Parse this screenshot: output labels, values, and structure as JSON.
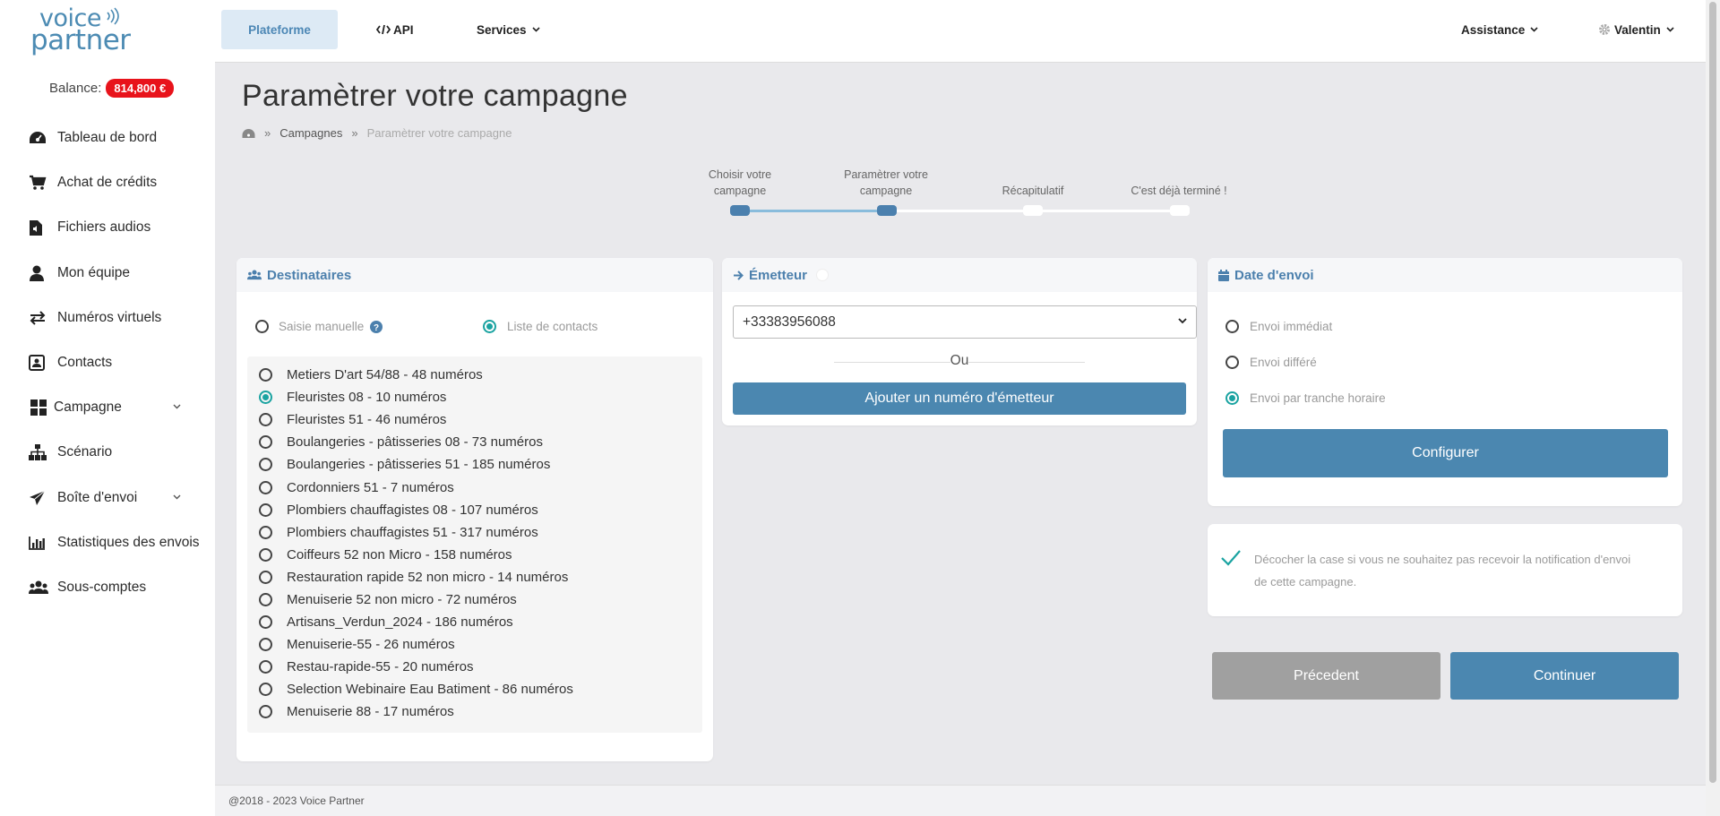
{
  "logo": {
    "line1": "voice",
    "line2": "partner"
  },
  "balance": {
    "label": "Balance:",
    "amount": "814,800 €"
  },
  "sidebar": {
    "items": [
      {
        "label": "Tableau de bord",
        "icon": "dashboard-icon"
      },
      {
        "label": "Achat de crédits",
        "icon": "cart-icon"
      },
      {
        "label": "Fichiers audios",
        "icon": "audio-file-icon"
      },
      {
        "label": "Mon équipe",
        "icon": "user-icon"
      },
      {
        "label": "Numéros virtuels",
        "icon": "exchange-icon"
      },
      {
        "label": "Contacts",
        "icon": "contact-card-icon"
      },
      {
        "label": "Campagne",
        "icon": "grid-icon"
      },
      {
        "label": "Scénario",
        "icon": "sitemap-icon"
      },
      {
        "label": "Boîte d'envoi",
        "icon": "paper-plane-icon"
      },
      {
        "label": "Statistiques des envois",
        "icon": "bar-chart-icon"
      },
      {
        "label": "Sous-comptes",
        "icon": "users-icon"
      }
    ]
  },
  "topbar": {
    "plateforme": "Plateforme",
    "api": "API",
    "services": "Services",
    "assistance": "Assistance",
    "user": "Valentin"
  },
  "page": {
    "title": "Paramètrer votre campagne",
    "breadcrumb": {
      "sep": "»",
      "campagnes": "Campagnes",
      "current": "Paramètrer votre campagne"
    }
  },
  "stepper": {
    "steps": [
      {
        "line1": "Choisir votre",
        "line2": "campagne"
      },
      {
        "line1": "Paramètrer votre",
        "line2": "campagne"
      },
      {
        "line1": "Récapitulatif",
        "line2": ""
      },
      {
        "line1": "C'est déjà terminé !",
        "line2": ""
      }
    ],
    "current_step": 2
  },
  "destinataires": {
    "title": "Destinataires",
    "mode_manual": "Saisie manuelle",
    "mode_list": "Liste de contacts",
    "selected_mode": "Liste de contacts",
    "lists": [
      "Metiers D'art 54/88 - 48 numéros",
      "Fleuristes 08 - 10 numéros",
      "Fleuristes 51 - 46 numéros",
      "Boulangeries - pâtisseries 08 - 73 numéros",
      "Boulangeries - pâtisseries 51 - 185 numéros",
      "Cordonniers 51 - 7 numéros",
      "Plombiers chauffagistes 08 - 107 numéros",
      "Plombiers chauffagistes 51 - 317 numéros",
      "Coiffeurs 52 non Micro - 158 numéros",
      "Restauration rapide 52 non micro - 14 numéros",
      "Menuiserie 52 non micro - 72 numéros",
      "Artisans_Verdun_2024 - 186 numéros",
      "Menuiserie-55 - 26 numéros",
      "Restau-rapide-55 - 20 numéros",
      "Selection Webinaire Eau Batiment - 86 numéros",
      "Menuiserie 88 - 17 numéros"
    ],
    "selected_list": "Fleuristes 08 - 10 numéros"
  },
  "emetteur": {
    "title": "Émetteur",
    "selected_number": "+33383956088",
    "or_label": "Ou",
    "add_button": "Ajouter un numéro d'émetteur"
  },
  "date_envoi": {
    "title": "Date d'envoi",
    "options": [
      "Envoi immédiat",
      "Envoi différé",
      "Envoi par tranche horaire"
    ],
    "selected": "Envoi par tranche horaire",
    "configure_button": "Configurer"
  },
  "notification": {
    "text_line1": "Décocher la case si vous ne souhaitez pas recevoir la notification d'envoi",
    "text_line2": "de cette campagne.",
    "checked": true
  },
  "actions": {
    "previous": "Précedent",
    "continue": "Continuer"
  },
  "footer": {
    "text": "@2018 - 2023 Voice Partner"
  },
  "colors": {
    "accent": "#4b87b0",
    "balance_badge": "#e8131b",
    "radio_on": "#1aa3a1"
  }
}
